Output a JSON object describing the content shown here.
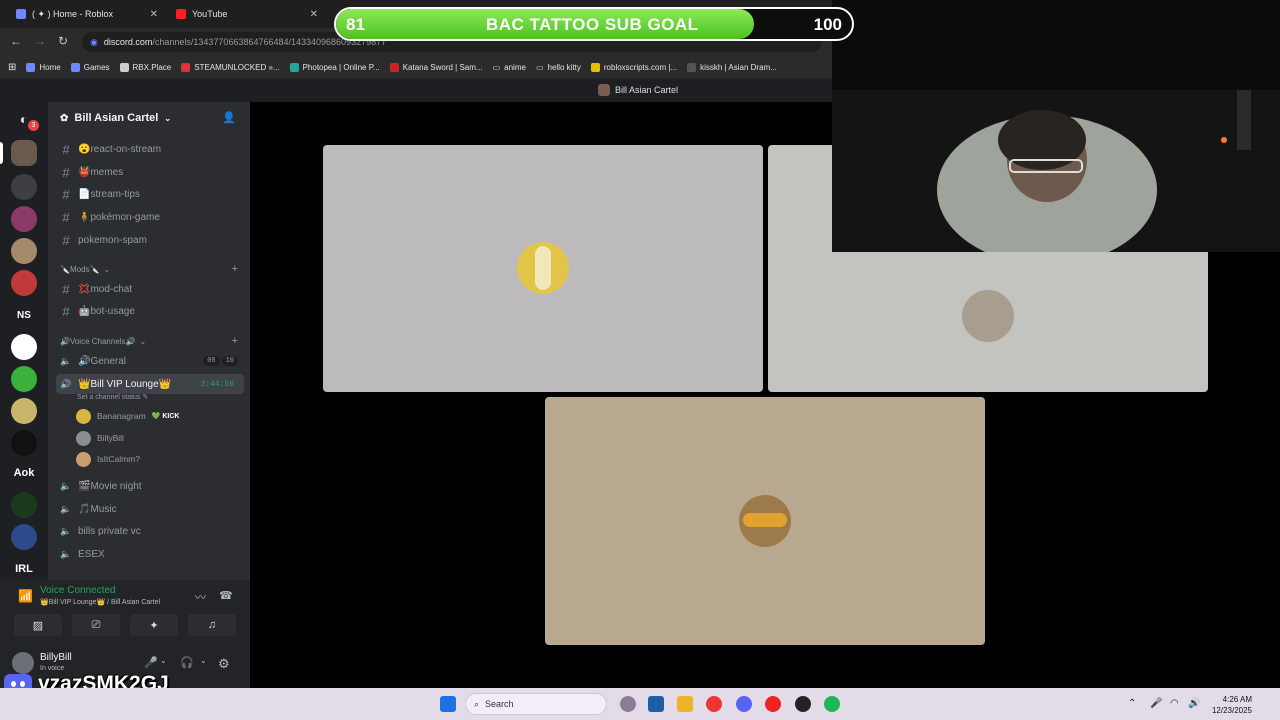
{
  "browser": {
    "tabs": [
      {
        "title": "( ✦ ) Home - Roblox"
      },
      {
        "title": "YouTube"
      }
    ],
    "url_domain": "discord.com",
    "url_path": "/channels/1343770663864766484/1433409686093279877",
    "bookmarks": [
      "Home",
      "Games",
      "RBX.Place",
      "STEAMUNLOCKED »...",
      "Photopea | Online P...",
      "Katana Sword | Sam...",
      "anime",
      "hello kitty",
      "robloxscripts.com |...",
      "kisskh | Asian Dram..."
    ]
  },
  "overlay": {
    "goal_current": "81",
    "goal_label": "BAC TATTOO SUB GOAL",
    "goal_max": "100",
    "goal_progress": 0.81
  },
  "discord": {
    "window_title": "Bill Asian Cartel",
    "guild_badge": "3",
    "guild_labels": [
      "NS",
      "Aok",
      "IRL"
    ],
    "server_name": "Bill Asian Cartel",
    "channels_top": [
      {
        "name": "😮react-on-stream"
      },
      {
        "name": "👹memes"
      },
      {
        "name": "📄stream-tips"
      },
      {
        "name": "🧍pokémon-game"
      },
      {
        "name": "pokemon-spam"
      }
    ],
    "mods_category": "🔪Mods🔪",
    "mods_channels": [
      {
        "name": "💢mod-chat"
      },
      {
        "name": "🤖bot-usage"
      }
    ],
    "voice_category": "🔊Voice Channels🔊",
    "voice_general": "🔊General",
    "general_count_a": "00",
    "general_count_b": "10",
    "active_voice": "👑Bill VIP Lounge👑",
    "active_timer": "3:44:56",
    "channel_status": "Set a channel status",
    "voice_users": [
      {
        "name": "Bananagram",
        "tag": "💚 KICK"
      },
      {
        "name": "BillyBill",
        "tag": ""
      },
      {
        "name": "IsItCalmm?",
        "tag": ""
      }
    ],
    "voice_more": [
      {
        "name": "🎬Movie night"
      },
      {
        "name": "🎵Music"
      },
      {
        "name": "bills private vc"
      },
      {
        "name": "ESEX"
      }
    ],
    "voice_connected": "Voice Connected",
    "voice_location": "👑Bill VIP Lounge👑 / Bill Asian Cartel",
    "user_name": "BillyBill",
    "user_status": "In voice"
  },
  "watermark": "vzazSMK2GJ",
  "taskbar": {
    "search_placeholder": "Search",
    "time": "4:26 AM",
    "date": "12/23/2025"
  },
  "colors": {
    "discord_bg": "#2b2d31",
    "accent_green": "#23a55a",
    "goal_green": "#6fd63b",
    "tile1": "#bcbabd",
    "tile2": "#c3c4bf",
    "tile3": "#b7a88f"
  }
}
